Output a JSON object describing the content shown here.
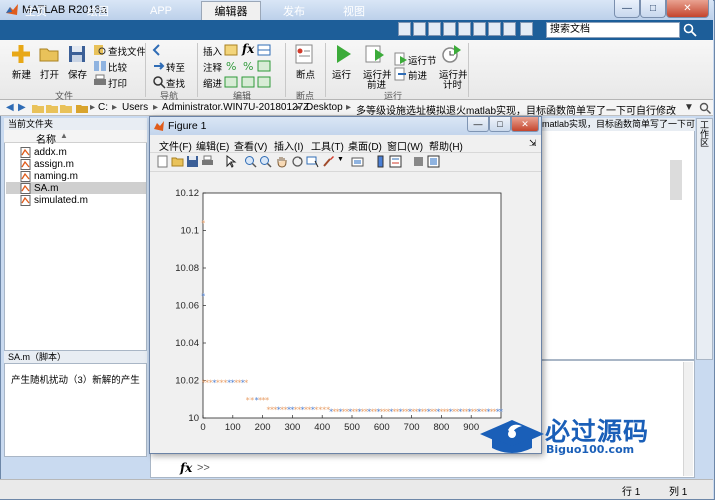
{
  "window": {
    "title": "MATLAB R2018a"
  },
  "tabs": [
    {
      "label": "主页"
    },
    {
      "label": "绘图"
    },
    {
      "label": "APP"
    },
    {
      "label": "编辑器"
    },
    {
      "label": "发布"
    },
    {
      "label": "视图"
    }
  ],
  "search": {
    "placeholder": "搜索文档"
  },
  "ribbon": {
    "file": {
      "new": "新建",
      "open": "打开",
      "save": "保存",
      "find_files": "查找文件",
      "compare": "比较",
      "print": "打印",
      "group": "文件"
    },
    "navigate": {
      "goto": "转至",
      "find": "查找",
      "group": "导航"
    },
    "edit": {
      "insert": "插入",
      "comment": "注释",
      "indent": "缩进",
      "group": "编辑"
    },
    "breakpoints": {
      "label": "断点",
      "group": "断点"
    },
    "run": {
      "run": "运行",
      "run_advance": "运行并前进",
      "run_section": "运行节",
      "advance": "前进",
      "run_time": "运行并计时",
      "group": "运行",
      "run_advance_l1": "运行并",
      "run_advance_l2": "前进",
      "run_time_l1": "运行并",
      "run_time_l2": "计时"
    }
  },
  "address": {
    "path": [
      "C:",
      "Users",
      "Administrator.WIN7U-20180127Z",
      "Desktop",
      "多等级设施选址模拟退火matlab实现，目标函数简单写了一下可自行修改"
    ]
  },
  "files_panel": {
    "title": "当前文件夹",
    "column": "名称",
    "files": [
      {
        "name": "addx.m"
      },
      {
        "name": "assign.m"
      },
      {
        "name": "naming.m"
      },
      {
        "name": "SA.m"
      },
      {
        "name": "simulated.m"
      }
    ]
  },
  "details": {
    "title": "SA.m（脚本）",
    "text": "产生随机扰动（3）新解的产生"
  },
  "editor": {
    "tab": "matlab实现，目标函数简单写了一下可..."
  },
  "workspace": {
    "label": "工作区"
  },
  "command": {
    "prompt": "fx",
    "arrows": ">>"
  },
  "status": {
    "row_label": "行",
    "row": "1",
    "col_label": "列",
    "col": "1"
  },
  "figure": {
    "title": "Figure 1",
    "menus": [
      "文件(F)",
      "编辑(E)",
      "查看(V)",
      "插入(I)",
      "工具(T)",
      "桌面(D)",
      "窗口(W)",
      "帮助(H)"
    ]
  },
  "logo": {
    "title": "必过源码",
    "subtitle": "Biguo100.com"
  },
  "colors": {
    "tab_bar": "#1d5e99",
    "logo": "#1a5fb8",
    "marker_main": "#e8a06a",
    "marker_alt": "#4d7fd1"
  },
  "chart_data": {
    "type": "scatter",
    "title": "",
    "xlabel": "",
    "ylabel": "",
    "xlim": [
      0,
      1000
    ],
    "ylim": [
      10,
      10.12
    ],
    "xticks": [
      0,
      100,
      200,
      300,
      400,
      500,
      600,
      700,
      800,
      900
    ],
    "yticks": [
      10,
      10.02,
      10.04,
      10.06,
      10.08,
      10.1,
      10.12
    ],
    "grid": false,
    "series": [
      {
        "points": [
          {
            "x": 1,
            "y": 10.104
          },
          {
            "x": 1,
            "y": 10.065
          },
          {
            "x": 2,
            "y": 10.019
          },
          {
            "x": 50,
            "y": 10.019
          },
          {
            "x": 100,
            "y": 10.019
          },
          {
            "x": 145,
            "y": 10.019
          },
          {
            "x": 150,
            "y": 10.0095
          },
          {
            "x": 180,
            "y": 10.0095
          },
          {
            "x": 215,
            "y": 10.0095
          },
          {
            "x": 220,
            "y": 10.0045
          },
          {
            "x": 300,
            "y": 10.0045
          },
          {
            "x": 380,
            "y": 10.0045
          },
          {
            "x": 420,
            "y": 10.0045
          },
          {
            "x": 430,
            "y": 10.0035
          },
          {
            "x": 600,
            "y": 10.0035
          },
          {
            "x": 800,
            "y": 10.0035
          },
          {
            "x": 1000,
            "y": 10.0035
          }
        ]
      }
    ]
  }
}
